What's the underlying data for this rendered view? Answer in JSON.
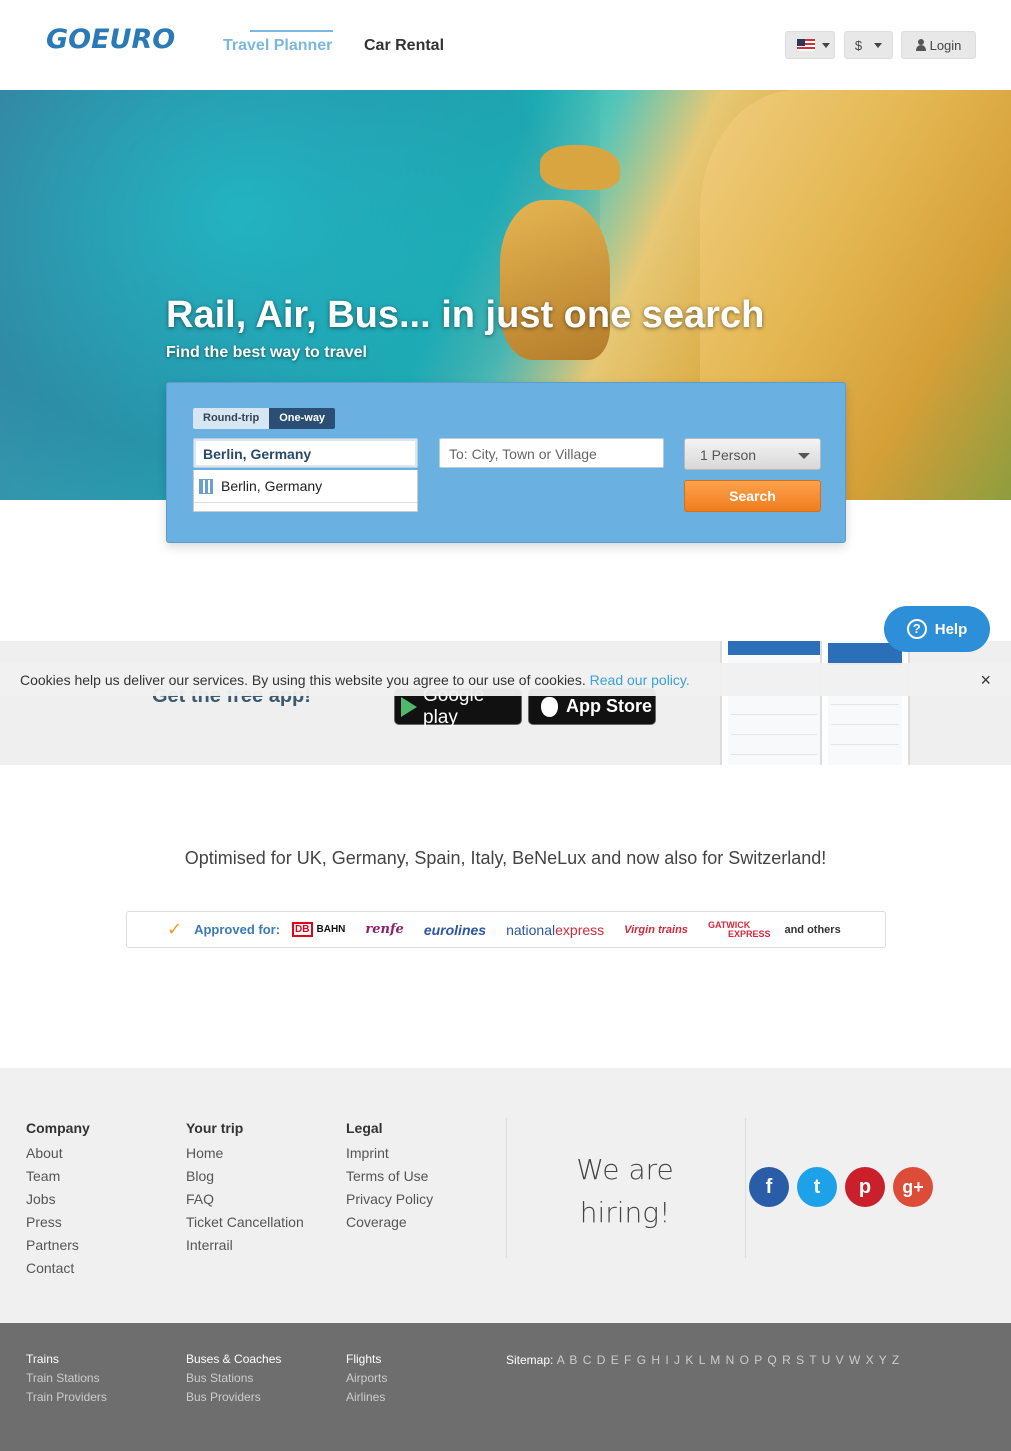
{
  "header": {
    "logo": "GOEURO",
    "nav": [
      "Travel Planner",
      "Car Rental"
    ],
    "currency": "$",
    "login": "Login"
  },
  "hero": {
    "title": "Rail, Air, Bus... in just one search",
    "subtitle": "Find the best way to travel"
  },
  "search": {
    "trip_round": "Round-trip",
    "trip_one": "One-way",
    "from_value": "Berlin, Germany",
    "to_placeholder": "To: City, Town or Village",
    "persons": "1 Person",
    "button": "Search",
    "suggestion": "Berlin, Germany"
  },
  "app": {
    "title": "Get the free app!",
    "google_play": "Google play",
    "app_store": "App Store"
  },
  "cookie": {
    "text": "Cookies help us deliver our services. By using this website you agree to our use of cookies.",
    "link": "Read our policy.",
    "close": "×"
  },
  "help": {
    "label": "Help",
    "icon": "?"
  },
  "optimised": "Optimised for UK, Germany, Spain, Italy, BeNeLux and now also for Switzerland!",
  "approved": {
    "check": "✓",
    "label": "Approved for:",
    "db": "DB",
    "bahn": "BAHN",
    "renfe": "renfe",
    "eurolines": "eurolines",
    "national_a": "national",
    "national_b": "express",
    "virgin": "Virgin trains",
    "gatwick_a": "GATWICK",
    "gatwick_b": "EXPRESS",
    "others": "and others"
  },
  "footer": {
    "company": {
      "title": "Company",
      "items": [
        "About",
        "Team",
        "Jobs",
        "Press",
        "Partners",
        "Contact"
      ]
    },
    "trip": {
      "title": "Your trip",
      "items": [
        "Home",
        "Blog",
        "FAQ",
        "Ticket Cancellation",
        "Interrail"
      ]
    },
    "legal": {
      "title": "Legal",
      "items": [
        "Imprint",
        "Terms of Use",
        "Privacy Policy",
        "Coverage"
      ]
    },
    "hiring_a": "We are",
    "hiring_b": "hiring!",
    "social": {
      "fb": "f",
      "tw": "t",
      "pi": "p",
      "gp": "g+"
    }
  },
  "footer2": {
    "trains": {
      "title": "Trains",
      "items": [
        "Train Stations",
        "Train Providers"
      ]
    },
    "buses": {
      "title": "Buses & Coaches",
      "items": [
        "Bus Stations",
        "Bus Providers"
      ]
    },
    "flights": {
      "title": "Flights",
      "items": [
        "Airports",
        "Airlines"
      ]
    },
    "sitemap_label": "Sitemap:",
    "sitemap_letters": "A B C D E F G H I J K L M N O P Q R S T U V W X Y Z"
  },
  "colors": {
    "brand": "#2a7ab8",
    "accent_orange": "#f07d1e",
    "help_blue": "#2c8fd8"
  },
  "icons": [
    "flag-us-icon",
    "user-icon",
    "building-icon",
    "play-icon",
    "apple-icon",
    "help-icon",
    "check-icon",
    "close-icon",
    "facebook-icon",
    "twitter-icon",
    "pinterest-icon",
    "googleplus-icon"
  ]
}
